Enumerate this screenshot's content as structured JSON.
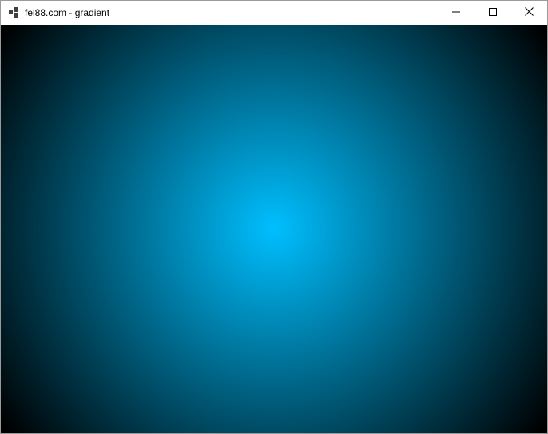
{
  "window": {
    "title": "fel88.com - gradient",
    "app_icon": "app-window-icon"
  },
  "titlebar": {
    "controls": [
      {
        "name": "minimize",
        "icon": "minimize-icon"
      },
      {
        "name": "maximize",
        "icon": "maximize-icon"
      },
      {
        "name": "close",
        "icon": "close-icon"
      }
    ]
  },
  "canvas": {
    "gradient_type": "radial",
    "center_color": "#00bfff",
    "edge_color": "#000000"
  }
}
